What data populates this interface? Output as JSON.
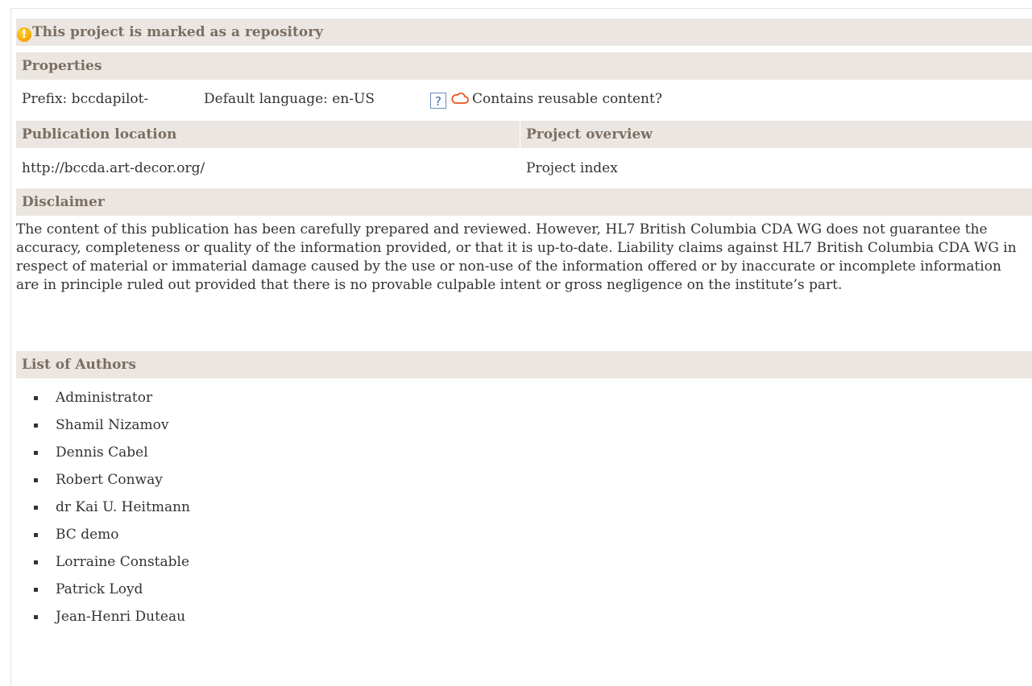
{
  "banner": {
    "icon": "warning-icon",
    "text": "This project is marked as a repository"
  },
  "properties": {
    "header": "Properties",
    "prefix": "Prefix: bccdapilot-",
    "default_language": "Default language: en-US",
    "help_icon_glyph": "?",
    "reusable_label": "Contains reusable content?"
  },
  "publication": {
    "header": "Publication location",
    "url": "http://bccda.art-decor.org/"
  },
  "overview": {
    "header": "Project overview",
    "link": "Project index"
  },
  "disclaimer": {
    "header": "Disclaimer",
    "text": "The content of this publication has been carefully prepared and reviewed. However, HL7 British Columbia CDA WG does not guarantee the accuracy, completeness or quality of the information provided, or that it is up-to-date. Liability claims against HL7 British Columbia CDA WG in respect of material or immaterial damage caused by the use or non-use of the information offered or by inaccurate or incomplete information are in principle ruled out provided that there is no provable culpable intent or gross negligence on the institute’s part."
  },
  "authors": {
    "header": "List of Authors",
    "items": [
      "Administrator",
      "Shamil Nizamov",
      "Dennis Cabel",
      "Robert Conway",
      "dr Kai U. Heitmann",
      "BC demo",
      "Lorraine Constable",
      "Patrick Loyd",
      "Jean-Henri Duteau"
    ]
  },
  "colors": {
    "band_bg": "#ebe6e1",
    "band_text": "#7b6e63",
    "warning": "#f4a300",
    "cloud": "#e8531f",
    "help": "#3c6a96"
  }
}
